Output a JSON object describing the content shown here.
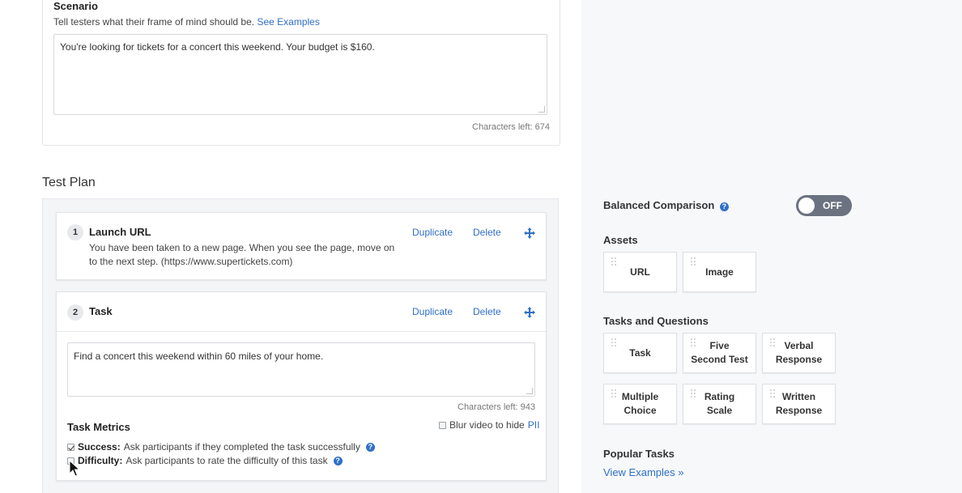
{
  "scenario": {
    "title": "Scenario",
    "help_text": "Tell testers what their frame of mind should be.",
    "help_link": "See Examples",
    "value": "You're looking for tickets for a concert this weekend. Your budget is $160.",
    "chars_left": "Characters left: 674"
  },
  "test_plan": {
    "title": "Test Plan",
    "steps": [
      {
        "number": "1",
        "title": "Launch URL",
        "body": "You have been taken to a new page. When you see the page, move on to the next step. (https://www.supertickets.com)",
        "duplicate": "Duplicate",
        "delete": "Delete"
      },
      {
        "number": "2",
        "title": "Task",
        "task_value": "Find a concert this weekend within 60 miles of your home.",
        "chars_left": "Characters left: 943",
        "duplicate": "Duplicate",
        "delete": "Delete",
        "metrics_title": "Task Metrics",
        "blur_label": "Blur video to hide",
        "blur_link": "PII",
        "blur_checked": false,
        "success": {
          "label": "Success:",
          "text": "Ask participants if they completed the task successfully",
          "checked": true
        },
        "difficulty": {
          "label": "Difficulty:",
          "text": "Ask participants to rate the difficulty of this task",
          "checked": false
        }
      }
    ]
  },
  "right_panel": {
    "balanced_label": "Balanced Comparison",
    "toggle_state": "OFF",
    "assets_title": "Assets",
    "assets": [
      "URL",
      "Image"
    ],
    "tasks_title": "Tasks and Questions",
    "tasks": [
      [
        "Task"
      ],
      [
        "Five",
        "Second Test"
      ],
      [
        "Verbal",
        "Response"
      ],
      [
        "Multiple",
        "Choice"
      ],
      [
        "Rating",
        "Scale"
      ],
      [
        "Written",
        "Response"
      ]
    ],
    "popular_title": "Popular Tasks",
    "view_examples": "View Examples »"
  },
  "colors": {
    "link": "#2f6fc7",
    "toggle_off": "#6b7280",
    "panel_bg": "#f7f8fa"
  }
}
